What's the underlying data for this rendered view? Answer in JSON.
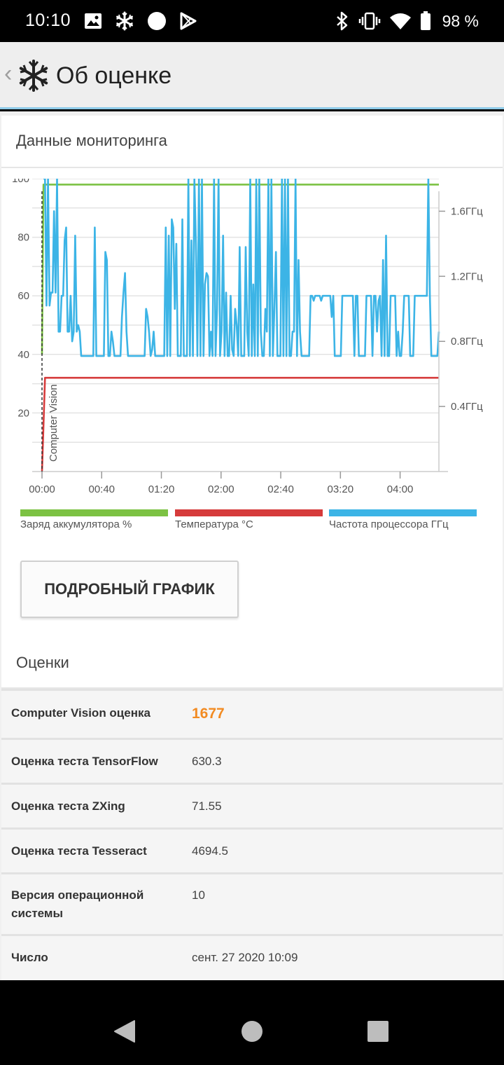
{
  "status_bar": {
    "time": "10:10",
    "battery_percent": "98 %",
    "left_icons": [
      "image-icon",
      "snowflake-icon",
      "circle-icon",
      "play-store-icon"
    ],
    "right_icons": [
      "bluetooth-icon",
      "vibrate-icon",
      "wifi-icon",
      "battery-icon"
    ]
  },
  "app_bar": {
    "title": "Об оценке",
    "logo_icon": "snowflake-logo-icon"
  },
  "monitoring": {
    "title": "Данные мониторинга",
    "legend": [
      {
        "label": "Заряд аккумулятора %",
        "color": "#7cc243"
      },
      {
        "label": "Температура °C",
        "color": "#d63b3b"
      },
      {
        "label": "Частота процессора ГГц",
        "color": "#3cb4e6"
      }
    ],
    "detail_button": "ПОДРОБНЫЙ ГРАФИК"
  },
  "chart_data": {
    "type": "line",
    "annotation": "Computer Vision",
    "x_ticks": [
      "00:00",
      "00:40",
      "01:20",
      "02:00",
      "02:40",
      "03:20",
      "04:00"
    ],
    "x_range_minutes": [
      0,
      266
    ],
    "y_left_ticks": [
      "20",
      "40",
      "60",
      "80",
      "100"
    ],
    "y_left_range": [
      0,
      100
    ],
    "y_right_ticks": [
      "0.4ГГц",
      "0.8ГГц",
      "1.2ГГц",
      "1.6ГГц"
    ],
    "y_right_range_ghz": [
      0,
      1.8
    ],
    "series": [
      {
        "name": "Заряд аккумулятора %",
        "color": "#7cc243",
        "axis": "left",
        "points": [
          [
            0,
            40
          ],
          [
            1,
            98
          ],
          [
            266,
            98
          ]
        ]
      },
      {
        "name": "Температура °C",
        "color": "#d63b3b",
        "axis": "left",
        "points": [
          [
            0,
            0
          ],
          [
            2,
            32
          ],
          [
            148,
            32
          ],
          [
            149,
            32
          ],
          [
            266,
            32
          ]
        ]
      },
      {
        "name": "Частота процессора ГГц",
        "color": "#3cb4e6",
        "axis": "right",
        "values": [
          1.8,
          1.8,
          1.02,
          1.8,
          1.02,
          1.1,
          1.1,
          1.6,
          1.1,
          1.8,
          0.86,
          0.86,
          1.08,
          1.08,
          1.42,
          1.5,
          0.86,
          0.86,
          1.08,
          0.8,
          0.86,
          1.45,
          0.86,
          0.9,
          0.86,
          0.71,
          0.71,
          0.71,
          0.71,
          0.71,
          0.71,
          0.71,
          0.71,
          0.71,
          1.5,
          0.71,
          0.71,
          0.71,
          0.71,
          0.71,
          0.71,
          1.35,
          1.3,
          0.71,
          0.71,
          0.86,
          0.8,
          0.71,
          0.71,
          0.71,
          0.71,
          0.71,
          0.95,
          1.1,
          1.22,
          0.86,
          0.71,
          0.71,
          0.71,
          0.71,
          0.71,
          0.71,
          0.71,
          0.71,
          0.71,
          0.71,
          0.71,
          0.71,
          1.0,
          0.95,
          0.85,
          0.71,
          0.75,
          0.86,
          0.71,
          0.71,
          0.71,
          0.71,
          0.71,
          0.71,
          0.71,
          1.5,
          0.71,
          1.45,
          0.71,
          1.55,
          1.5,
          1.0,
          1.4,
          0.71,
          0.71,
          0.71,
          1.55,
          0.71,
          0.71,
          0.71,
          1.8,
          0.71,
          1.42,
          0.71,
          1.8,
          1.4,
          0.71,
          1.8,
          0.71,
          1.8,
          0.71,
          1.15,
          1.22,
          1.2,
          0.71,
          0.86,
          0.71,
          1.8,
          0.71,
          1.0,
          1.8,
          0.71,
          0.86,
          1.45,
          0.71,
          1.1,
          0.71,
          0.71,
          1.08,
          0.75,
          0.71,
          1.0,
          0.9,
          0.71,
          1.38,
          0.71,
          0.71,
          0.71,
          1.38,
          0.86,
          0.71,
          1.8,
          0.71,
          1.15,
          0.71,
          1.8,
          0.71,
          1.8,
          0.86,
          0.71,
          0.71,
          1.0,
          0.86,
          1.8,
          0.71,
          1.8,
          0.71,
          1.0,
          1.35,
          0.71,
          0.71,
          0.71,
          1.8,
          0.71,
          1.8,
          0.71,
          1.8,
          0.71,
          0.71,
          0.86,
          0.86,
          1.8,
          0.71,
          1.3,
          0.86,
          0.71,
          0.71,
          0.71,
          0.71,
          0.71,
          0.71,
          1.08,
          1.08,
          1.05,
          1.08,
          1.08,
          1.08,
          1.08,
          1.05,
          1.08,
          1.08,
          1.08,
          1.08,
          1.08,
          1.08,
          0.95,
          1.08,
          0.71,
          0.71,
          0.71,
          0.71,
          0.71,
          1.08,
          1.08,
          1.08,
          1.08,
          1.08,
          1.08,
          1.08,
          1.08,
          0.71,
          1.08,
          1.08,
          0.71,
          0.71,
          0.71,
          0.71,
          0.71,
          1.08,
          1.08,
          1.08,
          1.08,
          0.71,
          1.08,
          1.08,
          0.86,
          1.05,
          1.08,
          0.71,
          1.3,
          0.71,
          1.45,
          0.71,
          0.71,
          1.08,
          1.08,
          1.08,
          1.08,
          0.71,
          0.86,
          0.71,
          0.71,
          0.86,
          1.08,
          1.08,
          1.08,
          1.08,
          0.71,
          0.71,
          0.71,
          1.08,
          1.08,
          1.08,
          1.08,
          1.08,
          1.08,
          1.08,
          1.08,
          1.08,
          1.8,
          1.08,
          0.71,
          0.71,
          0.71,
          0.71,
          0.71,
          0.86
        ]
      }
    ]
  },
  "scores": {
    "title": "Оценки",
    "rows": [
      {
        "key": "Computer Vision оценка",
        "value": "1677"
      },
      {
        "key": "Оценка теста TensorFlow",
        "value": "630.3"
      },
      {
        "key": "Оценка теста ZXing",
        "value": "71.55"
      },
      {
        "key": "Оценка теста Tesseract",
        "value": "4694.5"
      },
      {
        "key": "Версия операционной системы",
        "value": "10"
      },
      {
        "key": "Число",
        "value": "сент. 27 2020 10:09"
      }
    ]
  },
  "nav_bar": {
    "icons": [
      "back-triangle-icon",
      "home-circle-icon",
      "recents-square-icon"
    ]
  }
}
